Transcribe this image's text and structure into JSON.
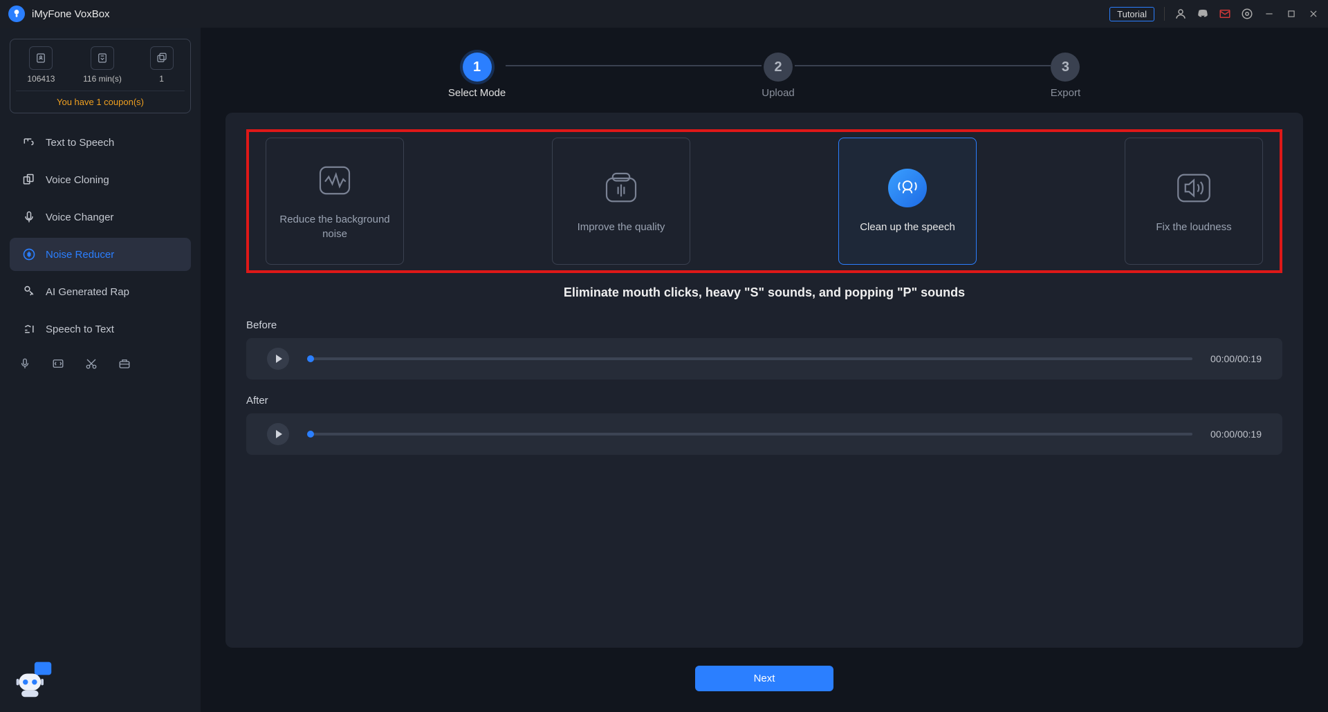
{
  "app": {
    "title": "iMyFone VoxBox"
  },
  "titlebar": {
    "tutorial": "Tutorial"
  },
  "stats": {
    "items": [
      {
        "value": "106413"
      },
      {
        "value": "116 min(s)"
      },
      {
        "value": "1"
      }
    ],
    "coupon": "You have 1 coupon(s)"
  },
  "nav": {
    "items": [
      {
        "label": "Text to Speech"
      },
      {
        "label": "Voice Cloning"
      },
      {
        "label": "Voice Changer"
      },
      {
        "label": "Noise Reducer"
      },
      {
        "label": "AI Generated Rap"
      },
      {
        "label": "Speech to Text"
      }
    ]
  },
  "stepper": {
    "steps": [
      {
        "num": "1",
        "label": "Select Mode"
      },
      {
        "num": "2",
        "label": "Upload"
      },
      {
        "num": "3",
        "label": "Export"
      }
    ]
  },
  "modes": {
    "items": [
      {
        "label": "Reduce the background noise"
      },
      {
        "label": "Improve the quality"
      },
      {
        "label": "Clean up the speech"
      },
      {
        "label": "Fix the loudness"
      }
    ]
  },
  "tagline": "Eliminate mouth clicks, heavy \"S\" sounds, and popping \"P\" sounds",
  "audio": {
    "before": {
      "label": "Before",
      "time": "00:00/00:19"
    },
    "after": {
      "label": "After",
      "time": "00:00/00:19"
    }
  },
  "next": "Next"
}
